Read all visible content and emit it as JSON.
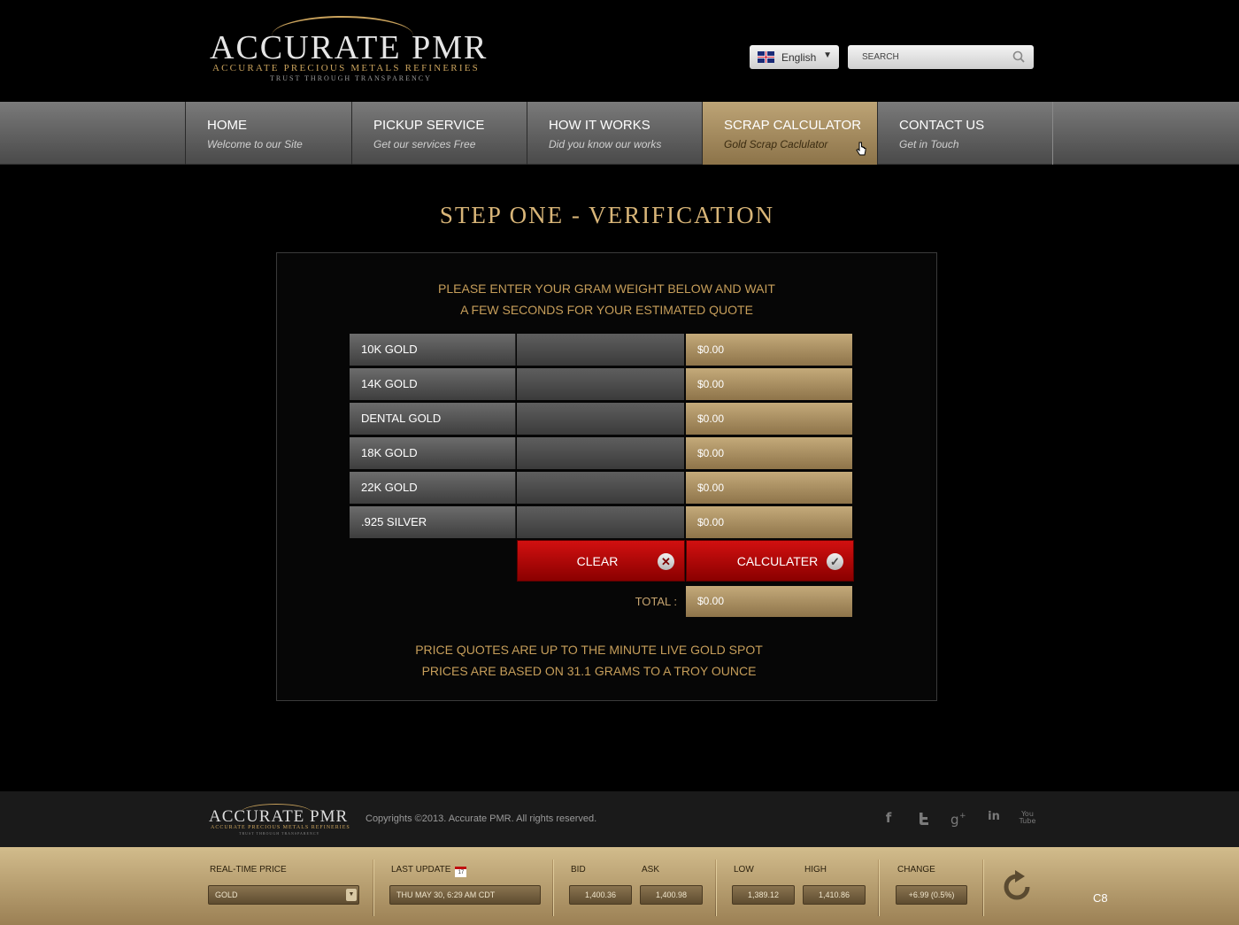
{
  "brand": {
    "name": "ACCURATE PMR",
    "tagline": "ACCURATE PRECIOUS METALS REFINERIES",
    "motto": "TRUST THROUGH TRANSPARENCY",
    "gold_color": "#c9a25c"
  },
  "header": {
    "language": "English",
    "search_placeholder": "SEARCH"
  },
  "nav": {
    "items": [
      {
        "title": "HOME",
        "subtitle": "Welcome to our Site"
      },
      {
        "title": "PICKUP SERVICE",
        "subtitle": "Get our services Free"
      },
      {
        "title": "HOW IT WORKS",
        "subtitle": "Did you know our works"
      },
      {
        "title": "SCRAP CALCULATOR",
        "subtitle": "Gold Scrap Caclulator"
      },
      {
        "title": "CONTACT US",
        "subtitle": "Get in Touch"
      }
    ],
    "active_index": 3
  },
  "calculator": {
    "title": "STEP ONE - VERIFICATION",
    "intro_line1": "PLEASE ENTER YOUR GRAM WEIGHT BELOW AND WAIT",
    "intro_line2": "A FEW SECONDS FOR YOUR ESTIMATED QUOTE",
    "rows": [
      {
        "label": "10K GOLD",
        "weight": "",
        "value": "$0.00"
      },
      {
        "label": "14K GOLD",
        "weight": "",
        "value": "$0.00"
      },
      {
        "label": "DENTAL GOLD",
        "weight": "",
        "value": "$0.00"
      },
      {
        "label": "18K GOLD",
        "weight": "",
        "value": "$0.00"
      },
      {
        "label": "22K GOLD",
        "weight": "",
        "value": "$0.00"
      },
      {
        "label": ".925 SILVER",
        "weight": "",
        "value": "$0.00"
      }
    ],
    "clear_label": "CLEAR",
    "calculate_label": "CALCULATER",
    "total_label": "TOTAL :",
    "total_value": "$0.00",
    "note_line1": "PRICE QUOTES ARE UP TO THE MINUTE LIVE GOLD SPOT",
    "note_line2": "PRICES ARE BASED ON 31.1 GRAMS TO A TROY OUNCE"
  },
  "footer": {
    "copyright": "Copyrights ©2013. Accurate PMR. All rights reserved.",
    "social": [
      "facebook-icon",
      "twitter-icon",
      "google-plus-icon",
      "linkedin-icon",
      "youtube-icon"
    ],
    "youtube_top": "You",
    "youtube_bottom": "Tube"
  },
  "ticker": {
    "realtime_label": "REAL-TIME PRICE",
    "metal": "GOLD",
    "last_update_label": "LAST UPDATE",
    "calendar_day": "17",
    "last_update": "THU MAY 30, 6:29 AM CDT",
    "bid_label": "BID",
    "bid": "1,400.36",
    "ask_label": "ASK",
    "ask": "1,400.98",
    "low_label": "LOW",
    "low": "1,389.12",
    "high_label": "HIGH",
    "high": "1,410.86",
    "change_label": "CHANGE",
    "change": "+6.99 (0.5%)",
    "corner_code": "C8"
  }
}
